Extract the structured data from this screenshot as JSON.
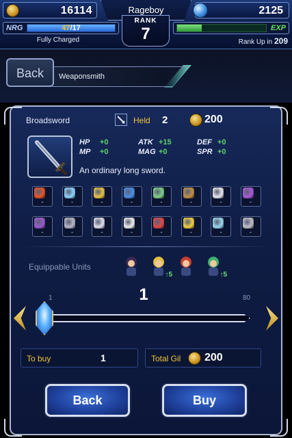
{
  "status": {
    "gil": "16114",
    "lapis": "2125",
    "player_name": "Rageboy",
    "rank_label": "RANK",
    "rank": "7",
    "nrg_label": "NRG",
    "nrg_current": "47",
    "nrg_max": "/17",
    "nrg_fraction": 1.0,
    "nrg_status": "Fully Charged",
    "exp_label": "EXP",
    "exp_fraction": 0.28,
    "rank_up_label": "Rank Up in",
    "rank_up_value": "209"
  },
  "header": {
    "back_label": "Back",
    "breadcrumb": "Weaponsmith"
  },
  "item": {
    "name": "Broadsword",
    "held_label": "Held",
    "held_count": "2",
    "price": "200",
    "description": "An ordinary long sword.",
    "stats": [
      {
        "label": "HP",
        "value": "+0"
      },
      {
        "label": "MP",
        "value": "+0"
      },
      {
        "label": "ATK",
        "value": "+15"
      },
      {
        "label": "MAG",
        "value": "+0"
      },
      {
        "label": "DEF",
        "value": "+0"
      },
      {
        "label": "SPR",
        "value": "+0"
      }
    ],
    "resistances_row1": [
      {
        "icon": "fire-icon",
        "value": "-",
        "color": "#e8542a"
      },
      {
        "icon": "ice-icon",
        "value": "-",
        "color": "#8fd4ff"
      },
      {
        "icon": "lightning-icon",
        "value": "-",
        "color": "#e8c448"
      },
      {
        "icon": "water-icon",
        "value": "-",
        "color": "#4a8fe8"
      },
      {
        "icon": "wind-icon",
        "value": "-",
        "color": "#7fd08a"
      },
      {
        "icon": "earth-icon",
        "value": "-",
        "color": "#c09048"
      },
      {
        "icon": "light-icon",
        "value": "-",
        "color": "#e8e8f0"
      },
      {
        "icon": "dark-icon",
        "value": "-",
        "color": "#a85ad8"
      }
    ],
    "resistances_row2": [
      {
        "icon": "poison-icon",
        "value": "-",
        "color": "#9a5ad0"
      },
      {
        "icon": "blind-icon",
        "value": "-",
        "color": "#b8b8c8"
      },
      {
        "icon": "sleep-icon",
        "value": "-",
        "color": "#e0e0f0"
      },
      {
        "icon": "silence-icon",
        "value": "-",
        "color": "#f0f0f0"
      },
      {
        "icon": "paralysis-icon",
        "value": "-",
        "color": "#e04848"
      },
      {
        "icon": "confuse-icon",
        "value": "-",
        "color": "#f0d040"
      },
      {
        "icon": "disease-icon",
        "value": "-",
        "color": "#9ad8f0"
      },
      {
        "icon": "petrify-icon",
        "value": "-",
        "color": "#c0c0c8"
      }
    ]
  },
  "equip": {
    "label": "Equippable Units",
    "units": [
      {
        "icon": "unit-dark-knight-icon",
        "bonus": "",
        "color": "#3a2a50"
      },
      {
        "icon": "unit-blonde-soldier-icon",
        "bonus": "5",
        "color": "#e0c040"
      },
      {
        "icon": "unit-redhead-icon",
        "bonus": "",
        "color": "#c84030"
      },
      {
        "icon": "unit-green-hair-icon",
        "bonus": "5",
        "color": "#40b070"
      }
    ]
  },
  "quantity": {
    "current": "1",
    "min": "1",
    "max": "80",
    "level_fraction": 0.0
  },
  "summary": {
    "to_buy_label": "To buy",
    "to_buy_value": "1",
    "total_label": "Total Gil",
    "total_value": "200"
  },
  "actions": {
    "back_label": "Back",
    "buy_label": "Buy"
  }
}
